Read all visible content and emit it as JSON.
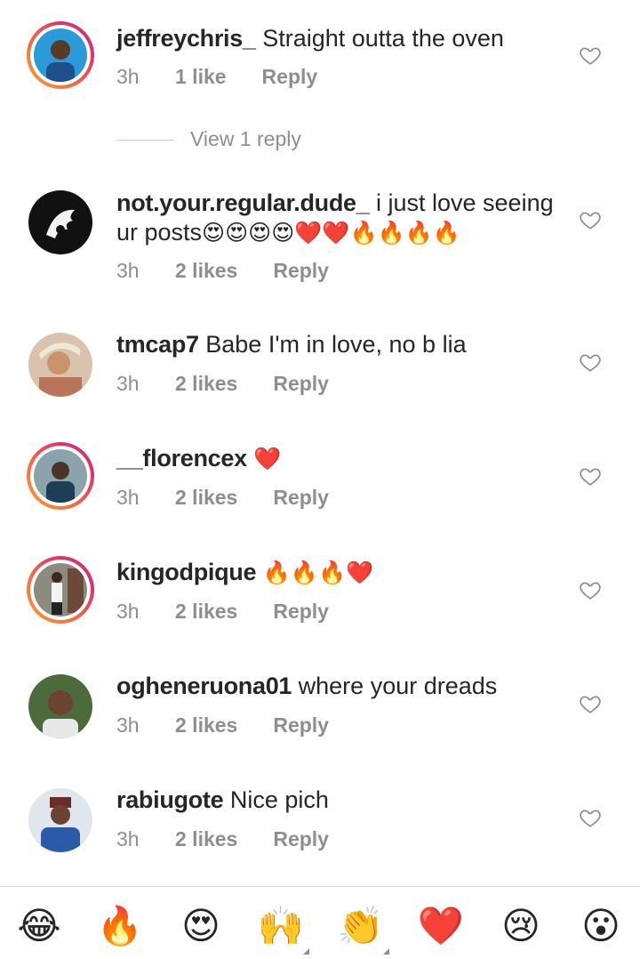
{
  "comments": [
    {
      "username": "jeffreychris_",
      "text": "Straight outta the oven",
      "emojis": "",
      "time": "3h",
      "likes": "1 like",
      "reply": "Reply",
      "view_replies": "View 1 reply",
      "avatar_bg": "#2a9bd8"
    },
    {
      "username": "not.your.regular.dude_",
      "text": "i just love seeing ur posts",
      "emojis": "😍😍😍😍❤️❤️🔥🔥🔥🔥",
      "time": "3h",
      "likes": "2 likes",
      "reply": "Reply",
      "avatar_bg": "#111111"
    },
    {
      "username": "tmcap7",
      "text": "Babe I'm in love, no b lia",
      "emojis": "",
      "time": "3h",
      "likes": "2 likes",
      "reply": "Reply",
      "avatar_bg": "#c9a98b"
    },
    {
      "username": "__florencex",
      "text": "",
      "emojis": "❤️",
      "time": "3h",
      "likes": "2 likes",
      "reply": "Reply",
      "avatar_bg": "#6f7f86"
    },
    {
      "username": "kingodpique",
      "text": "",
      "emojis": "🔥🔥🔥❤️",
      "time": "3h",
      "likes": "2 likes",
      "reply": "Reply",
      "avatar_bg": "#7c7a70"
    },
    {
      "username": "ogheneruona01",
      "text": "where your dreads",
      "emojis": "",
      "time": "3h",
      "likes": "2 likes",
      "reply": "Reply",
      "avatar_bg": "#4d6a3a"
    },
    {
      "username": "rabiugote",
      "text": "Nice pich",
      "emojis": "",
      "time": "3h",
      "likes": "2 likes",
      "reply": "Reply",
      "avatar_bg": "#2b5aa8"
    }
  ],
  "emoji_bar": [
    "😂",
    "🔥",
    "😍",
    "🙌",
    "👏",
    "❤️",
    "😢",
    "😮"
  ],
  "colors": {
    "text": "#262626",
    "meta": "#8e8e8e",
    "story_ring": "#f7673f",
    "heart_outline": "#8e8e8e"
  }
}
